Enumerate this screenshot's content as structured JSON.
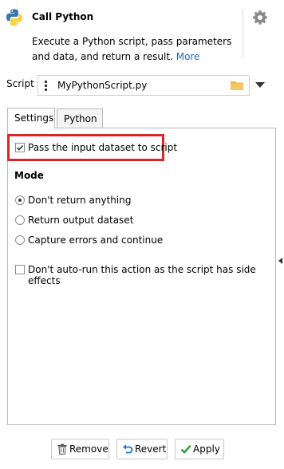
{
  "header": {
    "title": "Call Python",
    "description": "Execute a Python script, pass parameters and data, and return a result.",
    "more_link": "More"
  },
  "script": {
    "label": "Script",
    "value": "MyPythonScript.py"
  },
  "tabs": [
    {
      "label": "Settings",
      "active": true
    },
    {
      "label": "Python",
      "active": false
    }
  ],
  "settings": {
    "pass_input": {
      "label": "Pass the input dataset to script",
      "checked": true
    },
    "mode_heading": "Mode",
    "mode_options": [
      {
        "label": "Don't return anything",
        "selected": true
      },
      {
        "label": "Return output dataset",
        "selected": false
      },
      {
        "label": "Capture errors and continue",
        "selected": false
      }
    ],
    "no_autorun": {
      "label": "Don't auto-run this action as the script has side effects",
      "checked": false
    }
  },
  "footer": {
    "remove_label": "Remove",
    "revert_label": "Revert",
    "apply_label": "Apply"
  },
  "colors": {
    "highlight_border": "#d9262a",
    "link": "#1a6fc4",
    "apply_check": "#2e9b3a",
    "revert_arrow": "#1f6fc9",
    "folder": "#f2b84b",
    "python_blue": "#3b75ad",
    "python_yellow": "#f7cf3d"
  },
  "icons": [
    "python-logo-icon",
    "gear-icon",
    "drag-handle-icon",
    "folder-icon",
    "dropdown-arrow-icon",
    "trash-icon",
    "undo-arrow-icon",
    "check-icon",
    "collapse-arrow-icon"
  ]
}
